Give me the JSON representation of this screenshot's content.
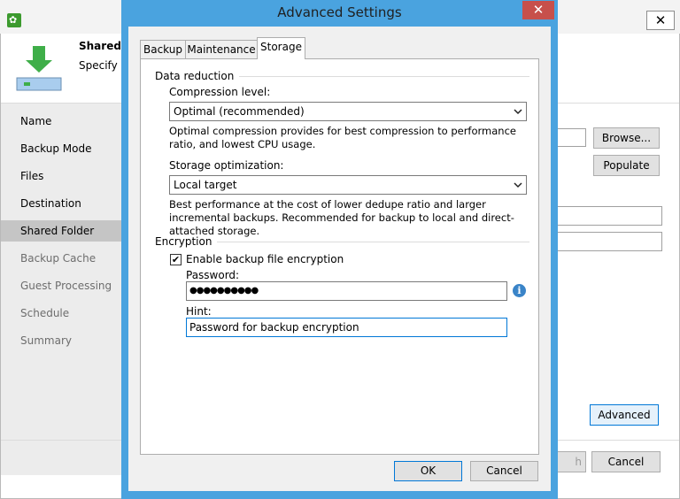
{
  "background_wizard": {
    "close_glyph": "✕",
    "header": {
      "title": "Shared F",
      "subtitle": "Specify a"
    },
    "steps": [
      {
        "label": "Name"
      },
      {
        "label": "Backup Mode"
      },
      {
        "label": "Files"
      },
      {
        "label": "Destination"
      },
      {
        "label": "Shared Folder"
      },
      {
        "label": "Backup Cache"
      },
      {
        "label": "Guest Processing"
      },
      {
        "label": "Schedule"
      },
      {
        "label": "Summary"
      }
    ],
    "selected_step": "Shared Folder",
    "buttons": {
      "browse": "Browse...",
      "populate": "Populate",
      "advanced": "Advanced",
      "finish_partial": "h",
      "cancel": "Cancel"
    }
  },
  "dialog": {
    "title": "Advanced Settings",
    "close_glyph": "✕",
    "tabs": [
      {
        "label": "Backup"
      },
      {
        "label": "Maintenance"
      },
      {
        "label": "Storage"
      }
    ],
    "active_tab": "Storage",
    "data_reduction": {
      "group_label": "Data reduction",
      "compression_label": "Compression level:",
      "compression_value": "Optimal (recommended)",
      "compression_desc": "Optimal compression provides for best compression to performance ratio, and lowest CPU usage.",
      "storage_opt_label": "Storage optimization:",
      "storage_opt_value": "Local target",
      "storage_opt_desc": "Best performance at the cost of lower dedupe ratio and larger incremental backups. Recommended for backup to local and direct-attached storage."
    },
    "encryption": {
      "group_label": "Encryption",
      "enable_label": "Enable backup file encryption",
      "enabled": true,
      "check_glyph": "✔",
      "password_label": "Password:",
      "password_mask": "●●●●●●●●●●",
      "info_glyph": "i",
      "hint_label": "Hint:",
      "hint_value": "Password for backup encryption"
    },
    "buttons": {
      "ok": "OK",
      "cancel": "Cancel"
    }
  },
  "colors": {
    "dialog_border": "#4aa3df",
    "close_red": "#c7504b",
    "accent": "#0078d7",
    "app_green": "#3c9a2e"
  }
}
